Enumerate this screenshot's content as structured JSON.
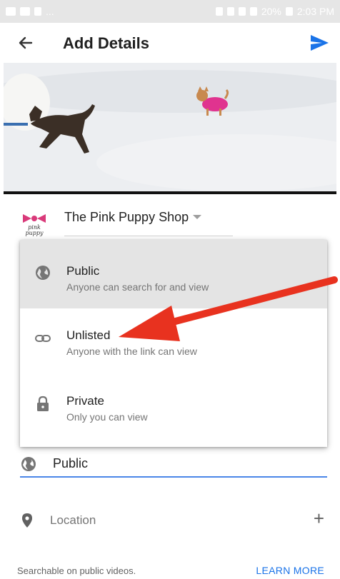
{
  "status_bar": {
    "left_text": "...",
    "right_text": "20%",
    "time": "2:03 PM"
  },
  "app_bar": {
    "title": "Add Details",
    "back_icon": "arrow-left-icon",
    "send_icon": "send-icon"
  },
  "channel": {
    "name": "The Pink Puppy Shop",
    "avatar_text": "pink puppy",
    "dropdown_icon": "caret-down-icon"
  },
  "privacy_menu": {
    "items": [
      {
        "title": "Public",
        "description": "Anyone can search for and view",
        "icon": "globe-icon",
        "selected": true
      },
      {
        "title": "Unlisted",
        "description": "Anyone with the link can view",
        "icon": "link-icon",
        "selected": false
      },
      {
        "title": "Private",
        "description": "Only you can view",
        "icon": "lock-icon",
        "selected": false
      }
    ]
  },
  "privacy_field": {
    "value": "Public",
    "icon": "globe-icon"
  },
  "location": {
    "label": "Location",
    "icon": "map-pin-icon",
    "add_icon": "plus-icon",
    "add_glyph": "+"
  },
  "footer": {
    "note": "Searchable on public videos.",
    "learn_more": "LEARN MORE"
  },
  "colors": {
    "accent_blue": "#1a73e8",
    "annotation_arrow": "#e8321f",
    "menu_selected_bg": "#e4e4e4"
  }
}
